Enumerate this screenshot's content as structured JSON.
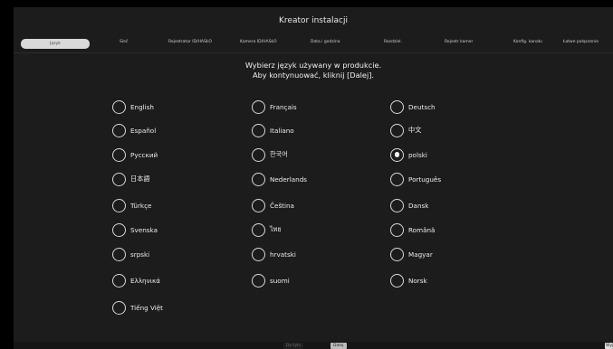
{
  "window": {
    "title": "Kreator instalacji"
  },
  "steps": [
    {
      "label": "Język",
      "active": true
    },
    {
      "label": "Sieć",
      "active": false
    },
    {
      "label": "Rejestrator ID/HASŁO",
      "active": false
    },
    {
      "label": "Kamera ID/HASŁO",
      "active": false
    },
    {
      "label": "Data i godzina",
      "active": false
    },
    {
      "label": "Rozdziel.",
      "active": false
    },
    {
      "label": "Rejestr kamer",
      "active": false
    },
    {
      "label": "Konfig. kanału",
      "active": false
    },
    {
      "label": "Łatwe połączenie",
      "active": false
    }
  ],
  "instruction": {
    "line1": "Wybierz język używany w produkcie.",
    "line2": "Aby kontynuować, kliknij [Dalej]."
  },
  "languages": [
    {
      "label": "English",
      "selected": false
    },
    {
      "label": "Français",
      "selected": false
    },
    {
      "label": "Deutsch",
      "selected": false
    },
    {
      "label": "Español",
      "selected": false
    },
    {
      "label": "Italiano",
      "selected": false
    },
    {
      "label": "中文",
      "selected": false
    },
    {
      "label": "Русский",
      "selected": false
    },
    {
      "label": "한국어",
      "selected": false
    },
    {
      "label": "polski",
      "selected": true
    },
    {
      "label": "日本語",
      "selected": false
    },
    {
      "label": "Nederlands",
      "selected": false
    },
    {
      "label": "Português",
      "selected": false
    },
    {
      "label": "Türkçe",
      "selected": false
    },
    {
      "label": "Čeština",
      "selected": false
    },
    {
      "label": "Dansk",
      "selected": false
    },
    {
      "label": "Svenska",
      "selected": false
    },
    {
      "label": "ไทย",
      "selected": false
    },
    {
      "label": "Română",
      "selected": false
    },
    {
      "label": "srpski",
      "selected": false
    },
    {
      "label": "hrvatski",
      "selected": false
    },
    {
      "label": "Magyar",
      "selected": false
    },
    {
      "label": "Ελληνικά",
      "selected": false
    },
    {
      "label": "suomi",
      "selected": false
    },
    {
      "label": "Norsk",
      "selected": false
    },
    {
      "label": "Tiếng Việt",
      "selected": false
    }
  ],
  "footer": {
    "back_label": "Do tyłu",
    "next_label": "Dalej",
    "corner_label": "Wyjdź"
  },
  "colors": {
    "background": "#000000",
    "panel": "#1c1c1c",
    "active_step": "#d9d9d9",
    "radio_border": "#d8d8d8"
  }
}
